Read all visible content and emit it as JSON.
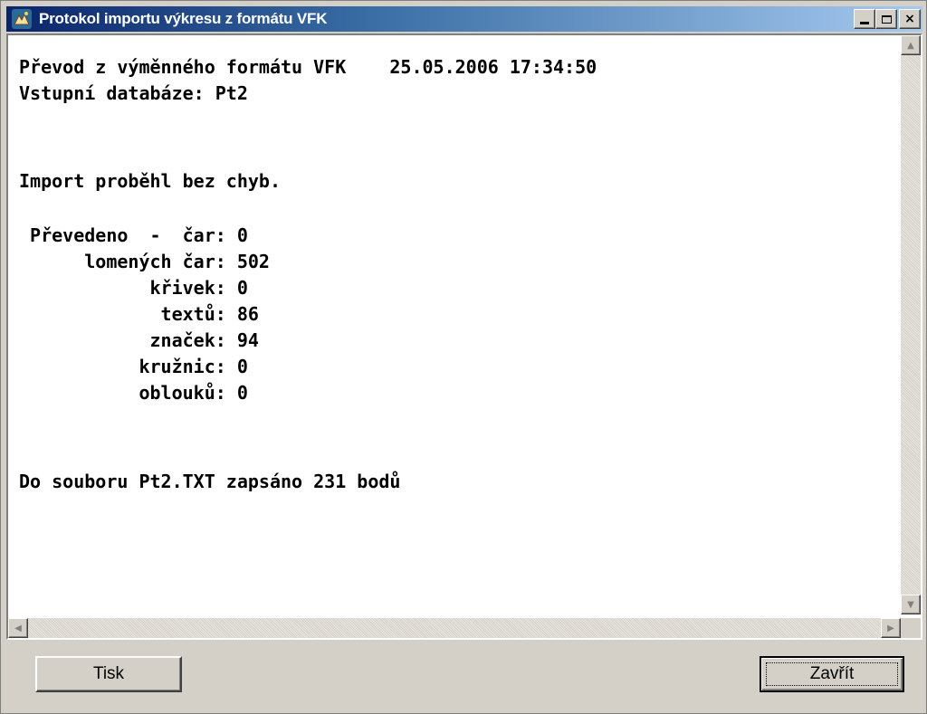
{
  "window": {
    "title": "Protokol importu výkresu z formátu VFK",
    "controls": {
      "minimize": "_",
      "maximize": "□",
      "close": "×"
    }
  },
  "log": {
    "lines": [
      "Převod z výměnného formátu VFK    25.05.2006 17:34:50",
      "Vstupní databáze: Pt2",
      "",
      "",
      "Import proběhl bez chyb.",
      "",
      " Převedeno  -  čar: 0",
      "      lomených čar: 502",
      "            křivek: 0",
      "             textů: 86",
      "            značek: 94",
      "           kružnic: 0",
      "           oblouků: 0",
      "",
      "",
      "Do souboru Pt2.TXT zapsáno 231 bodů"
    ]
  },
  "buttons": {
    "print_label": "Tisk",
    "close_label": "Zavřít"
  },
  "colors": {
    "titlebar_start": "#0a246a",
    "titlebar_end": "#a6caf0",
    "face": "#d4d0c8"
  }
}
